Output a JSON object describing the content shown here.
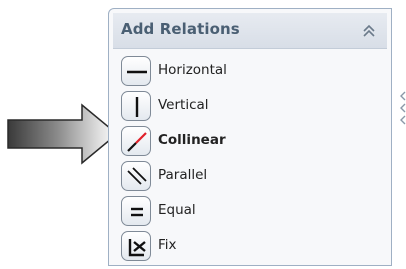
{
  "panel": {
    "title": "Add Relations",
    "items": [
      {
        "label": "Horizontal",
        "icon": "horizontal-line-icon",
        "bold": false
      },
      {
        "label": "Vertical",
        "icon": "vertical-line-icon",
        "bold": false
      },
      {
        "label": "Collinear",
        "icon": "collinear-icon",
        "bold": true
      },
      {
        "label": "Parallel",
        "icon": "parallel-icon",
        "bold": false
      },
      {
        "label": "Equal",
        "icon": "equal-icon",
        "bold": false
      },
      {
        "label": "Fix",
        "icon": "fix-icon",
        "bold": false
      }
    ]
  },
  "colors": {
    "title": "#4a5f73",
    "collinear_accent": "#e0202a",
    "border": "#9fb0c4"
  }
}
